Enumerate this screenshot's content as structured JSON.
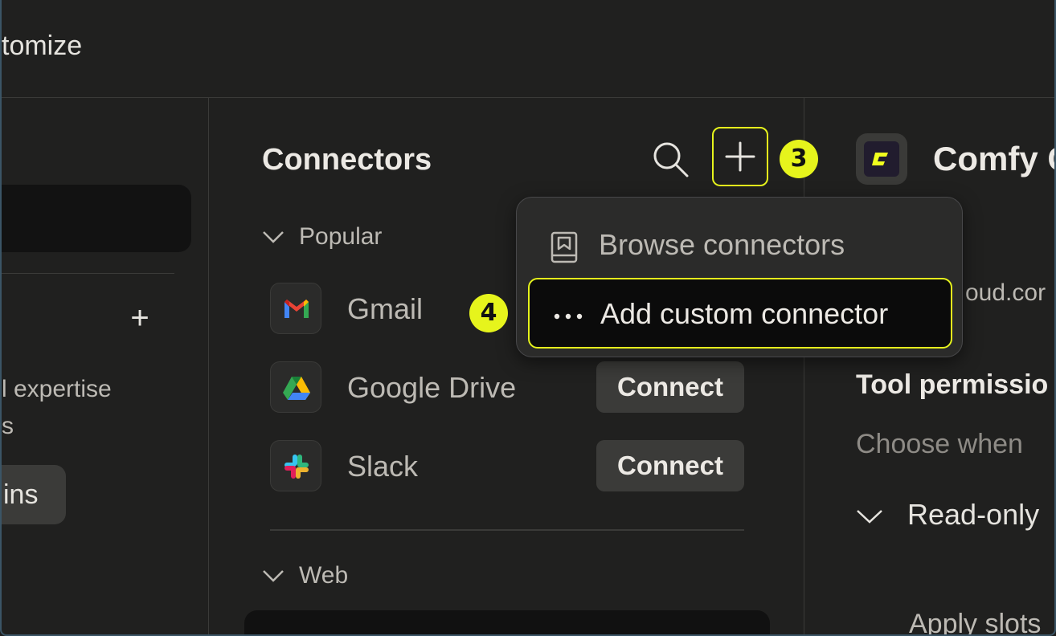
{
  "header": {
    "title": "tomize"
  },
  "left_panel": {
    "add_label": "+",
    "text_line_1": "l expertise",
    "text_line_2": "s",
    "pill_label": "ins"
  },
  "connectors": {
    "title": "Connectors",
    "sections": [
      {
        "label": "Popular"
      },
      {
        "label": "Web"
      }
    ],
    "items": [
      {
        "name": "Gmail",
        "icon": "gmail-icon"
      },
      {
        "name": "Google Drive",
        "icon": "google-drive-icon",
        "action": "Connect"
      },
      {
        "name": "Slack",
        "icon": "slack-icon",
        "action": "Connect"
      }
    ]
  },
  "menu": {
    "items": [
      {
        "label": "Browse connectors",
        "icon": "book-icon"
      },
      {
        "label": "Add custom connector",
        "icon": "ellipsis-icon"
      }
    ]
  },
  "annotations": {
    "step_3": "3",
    "step_4": "4",
    "highlight_color": "#e6f41c"
  },
  "detail": {
    "title": "Comfy C",
    "url": "oud.cor",
    "tool_permissions_title": "Tool permissio",
    "tool_permissions_desc": "Choose when",
    "read_only_label": "Read-only",
    "apply_label": "Apply slots"
  }
}
